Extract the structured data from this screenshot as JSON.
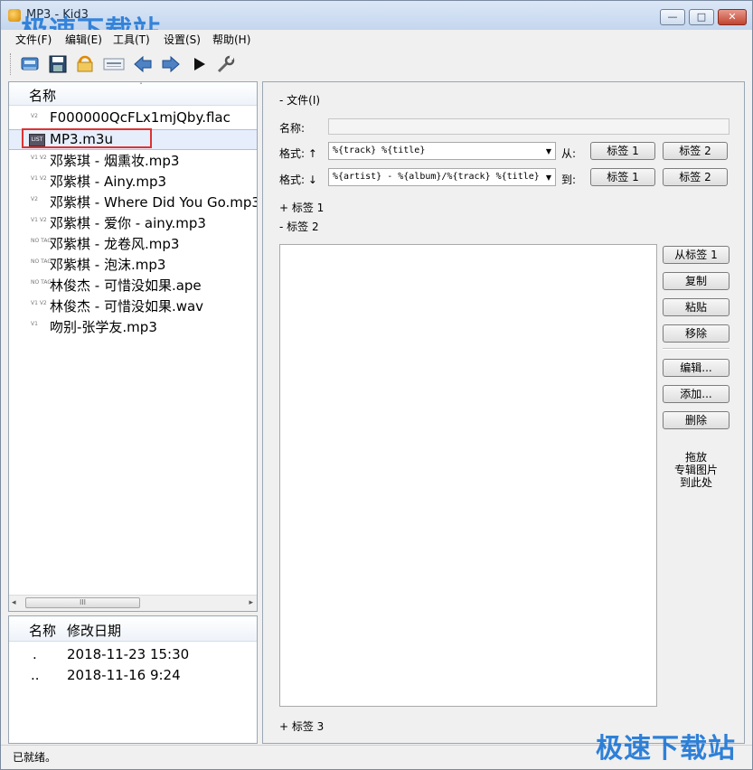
{
  "window": {
    "title": "MP3 - Kid3",
    "min_glyph": "—",
    "max_glyph": "□",
    "close_glyph": "✕"
  },
  "watermark": "极速下载站",
  "menu": [
    "文件(F)",
    "编辑(E)",
    "工具(T)",
    "设置(S)",
    "帮助(H)"
  ],
  "toolbar": [
    "open-icon",
    "save-icon",
    "revert-icon",
    "playlist-icon",
    "previous-icon",
    "next-icon",
    "play-icon",
    "settings-icon"
  ],
  "file_list": {
    "header": "名称",
    "sort_glyph": "ˆ",
    "items": [
      {
        "name": "F000000QcFLx1mjQby.flac",
        "tag": "V2"
      },
      {
        "name": "MP3.m3u",
        "tag": "LIST"
      },
      {
        "name": "邓紫琪 - 烟熏妆.mp3",
        "tag": "V1 V2"
      },
      {
        "name": "邓紫棋 - Ainy.mp3",
        "tag": "V1 V2"
      },
      {
        "name": "邓紫棋 - Where Did You Go.mp3",
        "tag": "V2"
      },
      {
        "name": "邓紫棋 - 爱你 - ainy.mp3",
        "tag": "V1 V2"
      },
      {
        "name": "邓紫棋 - 龙卷风.mp3",
        "tag": "NO TAG"
      },
      {
        "name": "邓紫棋 - 泡沫.mp3",
        "tag": "NO TAG"
      },
      {
        "name": "林俊杰 - 可惜没如果.ape",
        "tag": "NO TAG"
      },
      {
        "name": "林俊杰 - 可惜没如果.wav",
        "tag": "V1 V2"
      },
      {
        "name": "吻别-张学友.mp3",
        "tag": "V1"
      }
    ],
    "scroll_glyph": "III",
    "left_arrow": "◂",
    "right_arrow": "▸"
  },
  "dir_list": {
    "headers": [
      "名称",
      "修改日期"
    ],
    "rows": [
      {
        "name": ".",
        "date": "2018-11-23 15:30"
      },
      {
        "name": "..",
        "date": "2018-11-16 9:24"
      }
    ]
  },
  "right": {
    "file_section": "- 文件(I)",
    "name_label": "名称:",
    "format_up_label": "格式: ↑",
    "format_up_value": "%{track} %{title}",
    "from_label": "从:",
    "format_down_label": "格式: ↓",
    "format_down_value": "%{artist} - %{album}/%{track} %{title}",
    "to_label": "到:",
    "tag1_btn": "标签 1",
    "tag2_btn": "标签 2",
    "tag1_section": "+ 标签 1",
    "tag2_section": "- 标签 2",
    "tag3_section": "+ 标签 3",
    "dropdown_glyph": "▼",
    "side_buttons": [
      "从标签 1",
      "复制",
      "粘贴",
      "移除"
    ],
    "side_buttons2": [
      "编辑...",
      "添加...",
      "删除"
    ],
    "artwork_text": [
      "拖放",
      "专辑图片",
      "到此处"
    ]
  },
  "status": "已就绪。"
}
